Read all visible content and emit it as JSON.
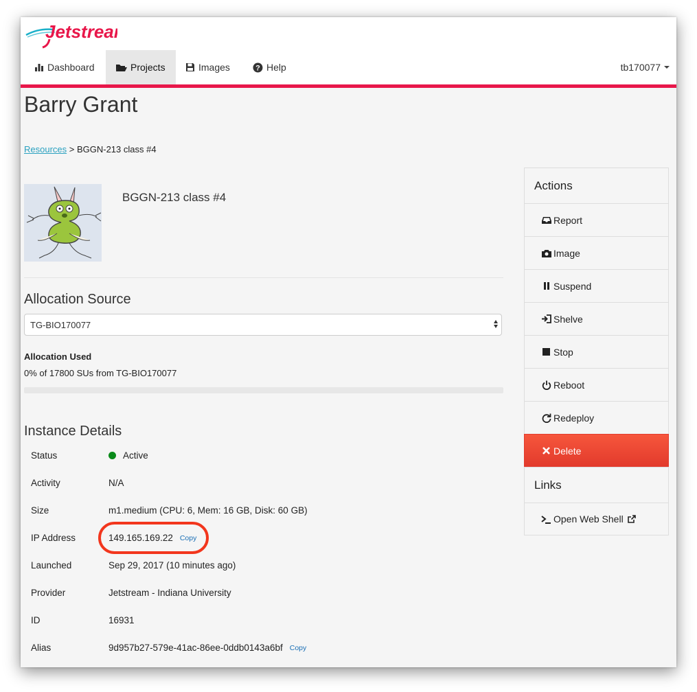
{
  "app": {
    "logo_text": "Jetstream",
    "colors": {
      "accent": "#e8174a",
      "link": "#2aa1c0",
      "delete": "#f04a33",
      "status_active": "#0a8a1a",
      "highlight": "#f2361d"
    }
  },
  "nav": {
    "items": [
      {
        "label": "Dashboard",
        "icon": "bar-chart-icon",
        "active": false
      },
      {
        "label": "Projects",
        "icon": "folder-open-icon",
        "active": true
      },
      {
        "label": "Images",
        "icon": "floppy-disk-icon",
        "active": false
      },
      {
        "label": "Help",
        "icon": "question-circle-icon",
        "active": false
      }
    ],
    "user": "tb170077"
  },
  "page": {
    "title": "Barry Grant"
  },
  "breadcrumb": {
    "link": "Resources",
    "current": "> BGGN-213 class #4"
  },
  "instance": {
    "name": "BGGN-213 class #4",
    "avatar_icon": "monster-avatar-icon"
  },
  "allocation": {
    "title": "Allocation Source",
    "selected": "TG-BIO170077",
    "used_label": "Allocation Used",
    "used_text": "0% of 17800 SUs from TG-BIO170077",
    "used_fraction": 0
  },
  "details": {
    "title": "Instance Details",
    "rows": [
      {
        "key": "Status",
        "value": "Active"
      },
      {
        "key": "Activity",
        "value": "N/A"
      },
      {
        "key": "Size",
        "value": "m1.medium (CPU: 6, Mem: 16 GB, Disk: 60 GB)"
      },
      {
        "key": "IP Address",
        "value": "149.165.169.22",
        "copy": "Copy"
      },
      {
        "key": "Launched",
        "value": "Sep 29, 2017 (10 minutes ago)"
      },
      {
        "key": "Provider",
        "value": "Jetstream - Indiana University"
      },
      {
        "key": "ID",
        "value": "16931"
      },
      {
        "key": "Alias",
        "value": "9d957b27-579e-41ac-86ee-0ddb0143a6bf",
        "copy": "Copy"
      }
    ]
  },
  "actions": {
    "title": "Actions",
    "items": [
      {
        "label": "Report",
        "icon": "inbox-icon"
      },
      {
        "label": "Image",
        "icon": "camera-icon"
      },
      {
        "label": "Suspend",
        "icon": "pause-icon"
      },
      {
        "label": "Shelve",
        "icon": "log-in-icon"
      },
      {
        "label": "Stop",
        "icon": "stop-icon"
      },
      {
        "label": "Reboot",
        "icon": "power-icon"
      },
      {
        "label": "Redeploy",
        "icon": "refresh-icon"
      },
      {
        "label": "Delete",
        "icon": "remove-icon"
      }
    ]
  },
  "links": {
    "title": "Links",
    "items": [
      {
        "label": "Open Web Shell",
        "icon": "terminal-icon",
        "external_icon": "external-link-icon"
      }
    ]
  }
}
